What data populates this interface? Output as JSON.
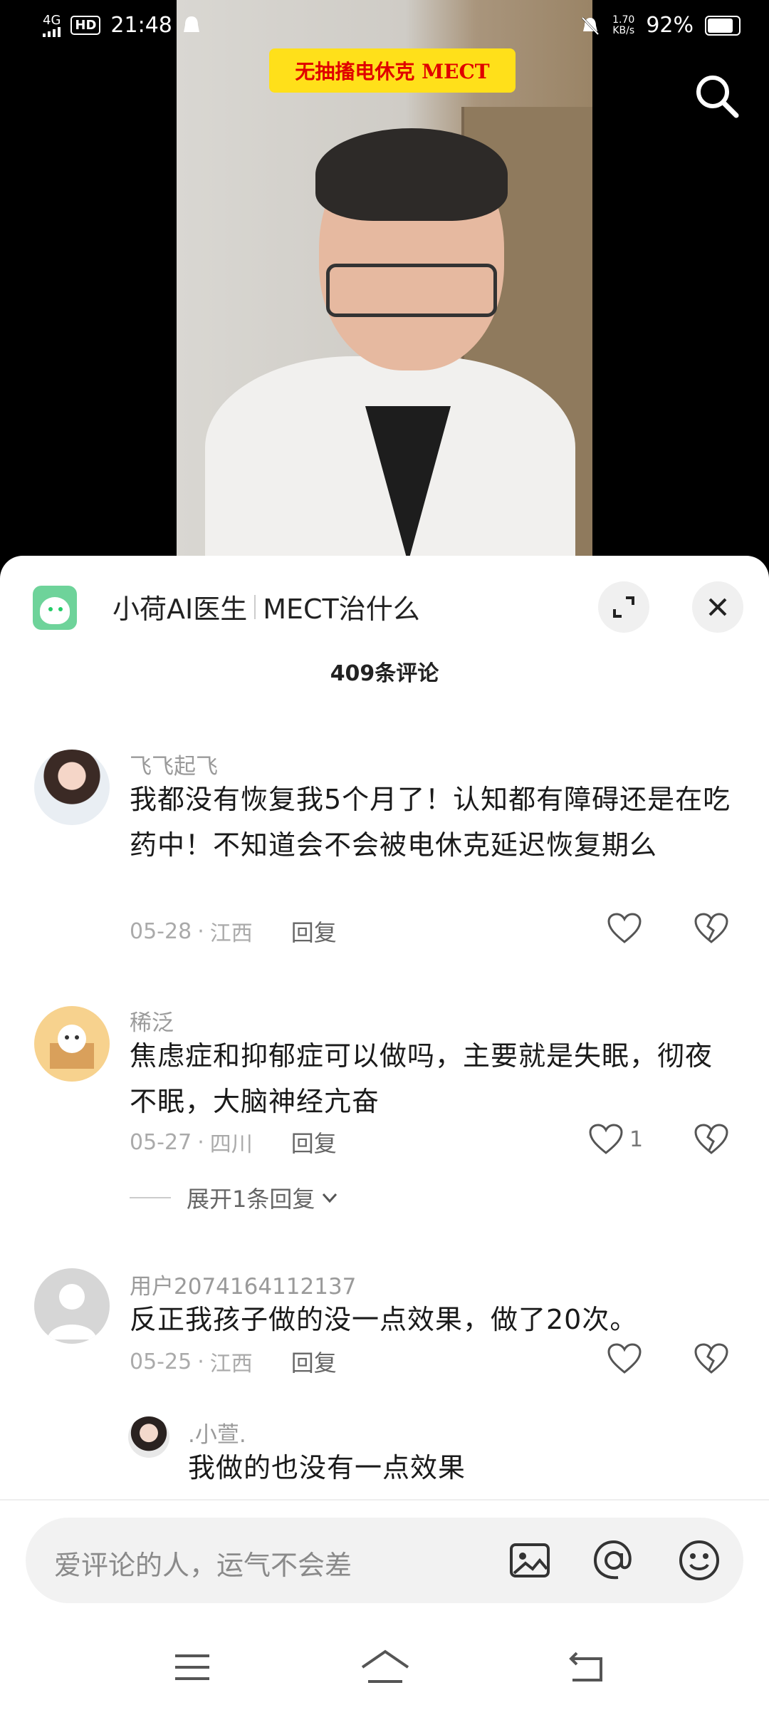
{
  "status_bar": {
    "network": "4G",
    "hd": "HD",
    "time": "21:48",
    "speed_top": "1.70",
    "speed_bottom": "KB/s",
    "battery_text": "92%",
    "battery_level": 0.92
  },
  "video": {
    "banner_text": "无抽搐电休克 MECT"
  },
  "sheet": {
    "account_name": "小荷AI医生",
    "video_title": "MECT治什么",
    "comment_count": "409条评论"
  },
  "comments": [
    {
      "user": "飞飞起飞",
      "text": "我都没有恢复我5个月了！认知都有障碍还是在吃药中！不知道会不会被电休克延迟恢复期么",
      "date": "05-28",
      "location": "江西",
      "reply_label": "回复",
      "likes": ""
    },
    {
      "user": "稀泛",
      "text": "焦虑症和抑郁症可以做吗，主要就是失眠，彻夜不眠，大脑神经亢奋",
      "date": "05-27",
      "location": "四川",
      "reply_label": "回复",
      "likes": "1",
      "expand_label": "展开1条回复"
    },
    {
      "user": "用户2074164112137",
      "text": "反正我孩子做的没一点效果，做了20次。",
      "date": "05-25",
      "location": "江西",
      "reply_label": "回复",
      "likes": ""
    }
  ],
  "reply": {
    "user": ".小萱.",
    "text": "我做的也没有一点效果"
  },
  "input": {
    "placeholder": "爱评论的人，运气不会差"
  },
  "colors": {
    "banner_bg": "#ffe01a",
    "banner_text": "#e00000",
    "logo_green": "#6ed39a"
  }
}
